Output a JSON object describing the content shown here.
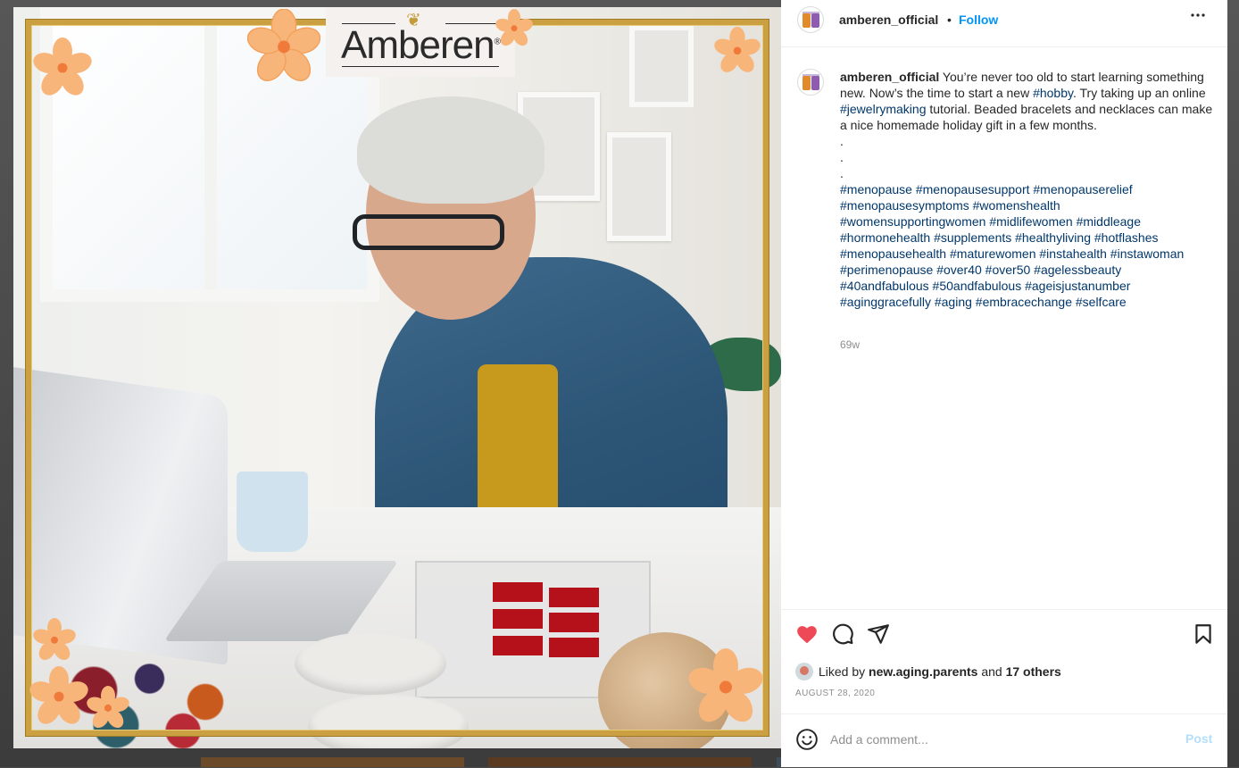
{
  "post": {
    "username": "amberen_official",
    "follow_label": "Follow",
    "separator": "•",
    "more_label": "•••"
  },
  "media": {
    "logo_text": "Amberen",
    "logo_registered": "®"
  },
  "caption": {
    "username": "amberen_official",
    "text_1": "You’re never too old to start learning something new. Now’s the time to start a new ",
    "tag_hobby": "#hobby",
    "text_2": ". Try taking up an online ",
    "tag_jewelry": "#jewelrymaking",
    "text_3": " tutorial. Beaded bracelets and necklaces can make a nice homemade holiday gift in a few months.",
    "dots": [
      ".",
      ".",
      "."
    ],
    "hashtags": [
      "#menopause",
      "#menopausesupport",
      "#menopauserelief",
      "#menopausesymptoms",
      "#womenshealth",
      "#womensupportingwomen",
      "#midlifewomen",
      "#middleage",
      "#hormonehealth",
      "#supplements",
      "#healthyliving",
      "#hotflashes",
      "#menopausehealth",
      "#maturewomen",
      "#instahealth",
      "#instawoman",
      "#perimenopause",
      "#over40",
      "#over50",
      "#agelessbeauty",
      "#40andfabulous",
      "#50andfabulous",
      "#ageisjustanumber",
      "#aginggracefully",
      "#aging",
      "#embracechange",
      "#selfcare"
    ],
    "time_ago": "69w"
  },
  "actions": {
    "like_icon": "heart-filled-icon",
    "comment_icon": "comment-icon",
    "share_icon": "paper-plane-icon",
    "save_icon": "bookmark-icon",
    "liked_by_prefix": "Liked by ",
    "liked_by_user": "new.aging.parents",
    "liked_by_and": " and ",
    "liked_by_others": "17 others",
    "date": "AUGUST 28, 2020"
  },
  "comment": {
    "placeholder": "Add a comment...",
    "post_label": "Post",
    "emoji_icon": "smiley-icon"
  },
  "colors": {
    "link": "#00376b",
    "follow": "#0095f6",
    "like": "#ed4956",
    "post_disabled": "#b2dffc",
    "frame_gold": "#caa042"
  }
}
